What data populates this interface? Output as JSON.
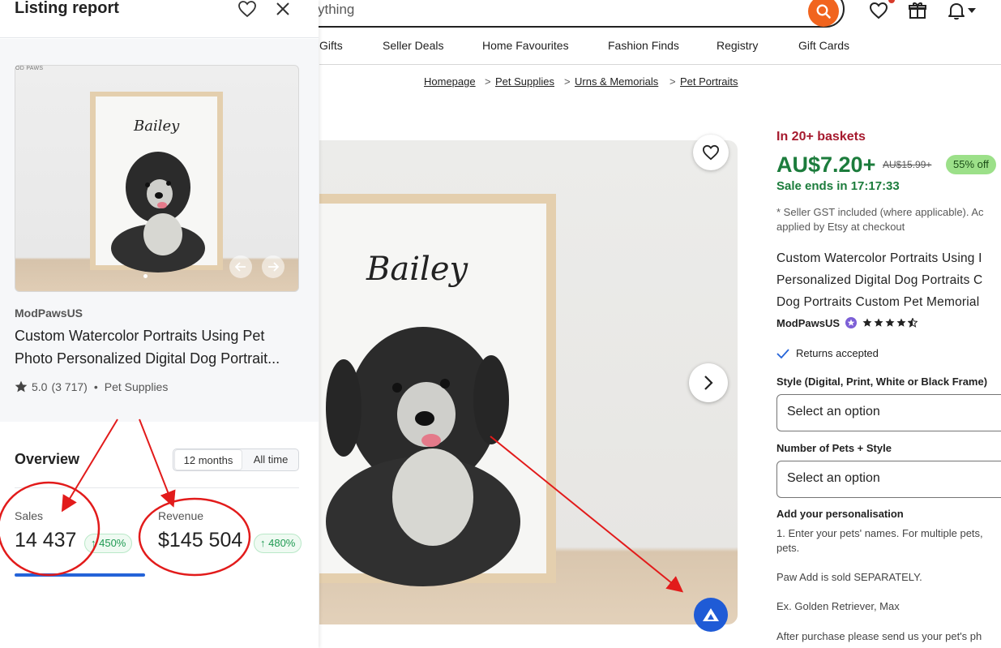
{
  "header": {
    "search_placeholder": "ything",
    "icons": [
      "search-icon",
      "heart-icon",
      "gift-icon",
      "bell-icon",
      "chevron-down-icon"
    ]
  },
  "nav": {
    "items": [
      "Gifts",
      "Seller Deals",
      "Home Favourites",
      "Fashion Finds",
      "Registry",
      "Gift Cards"
    ]
  },
  "breadcrumb": {
    "items": [
      "Homepage",
      "Pet Supplies",
      "Urns & Memorials",
      "Pet Portraits"
    ],
    "separator": ">"
  },
  "hero": {
    "frame_script": "Bailey"
  },
  "product": {
    "baskets": "In 20+ baskets",
    "price": "AU$7.20+",
    "original_price": "AU$15.99+",
    "discount": "55% off",
    "sale_ends": "Sale ends in 17:17:33",
    "gst_line1": "* Seller GST included (where applicable). Ac",
    "gst_line2": "applied by Etsy at checkout",
    "title_line1": "Custom Watercolor Portraits Using I",
    "title_line2": "Personalized Digital Dog Portraits C",
    "title_line3": "Dog Portraits Custom Pet Memorial",
    "shop": "ModPawsUS",
    "rating_stars": 4.5,
    "returns": "Returns accepted",
    "style_label": "Style (Digital, Print, White or Black Frame)",
    "style_value": "Select an option",
    "pets_label": "Number of Pets + Style",
    "pets_value": "Select an option",
    "personalisation_label": "Add your personalisation",
    "desc_line1": "1. Enter your pets' names. For multiple pets,",
    "desc_line2": "pets.",
    "desc_line3": "Paw Add is sold SEPARATELY.",
    "desc_line4": "Ex. Golden Retriever, Max",
    "desc_line5": "After purchase please send us your pet's ph"
  },
  "panel": {
    "title": "Listing report",
    "brand_mark": "OD PAWS",
    "frame_script": "Bailey",
    "shop_name": "ModPawsUS",
    "title_line1": "Custom Watercolor Portraits Using Pet",
    "title_line2": "Photo Personalized Digital Dog Portrait...",
    "rating": "5.0",
    "reviews": "(3 717)",
    "dot": "•",
    "category": "Pet Supplies",
    "overview_label": "Overview",
    "toggle_12": "12 months",
    "toggle_all": "All time",
    "sales_label": "Sales",
    "sales_value": "14 437",
    "sales_growth": "↑ 450%",
    "revenue_label": "Revenue",
    "revenue_value": "$145 504",
    "revenue_growth": "↑ 480%"
  },
  "colors": {
    "etsy_orange": "#f1641e",
    "price_green": "#1c7c3c",
    "baskets_red": "#a61a2e",
    "annotation_red": "#e21b1b",
    "sales_bar_blue": "#2463d8"
  }
}
